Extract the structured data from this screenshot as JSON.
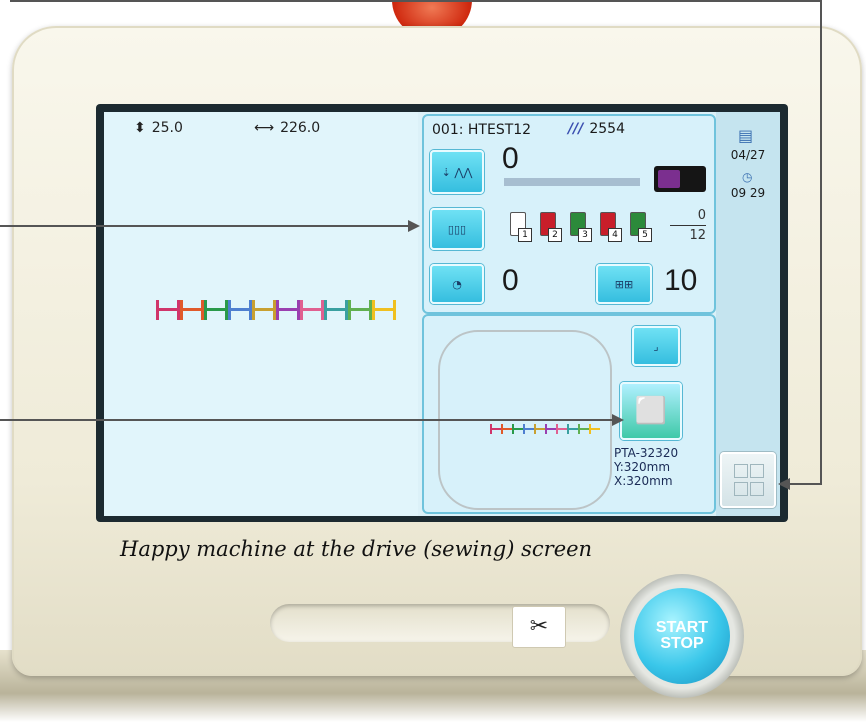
{
  "header": {
    "app_title": "",
    "dim_height": "25.0",
    "dim_width": "226.0"
  },
  "design": {
    "name": "001: HTEST12",
    "total_stitches": "2554"
  },
  "current_stitch": "0",
  "needles": {
    "count": "0",
    "total": "12",
    "spool_labels": [
      "1",
      "2",
      "3",
      "4",
      "5"
    ],
    "spool_colors": [
      "#ffffff",
      "#c81e2a",
      "#2c8a3a",
      "#c81e2a",
      "#2c8a3a"
    ]
  },
  "speed": "0",
  "needle_number": "10",
  "hoop": {
    "name": "PTA-32320",
    "y": "Y:320mm",
    "x": "X:320mm"
  },
  "clock": {
    "date": "04/27",
    "time": "09 29"
  },
  "caption": "Happy machine at the drive (sewing) screen",
  "panel": {
    "start_line1": "START",
    "start_line2": "STOP",
    "scissor": "✂"
  },
  "colors": {
    "mark_colors": [
      "#d0356a",
      "#e05a2a",
      "#2a9a4a",
      "#4e7fd0",
      "#c8a030",
      "#9a3fb0",
      "#e06090",
      "#3aa0a0",
      "#60b050",
      "#f0c020"
    ]
  }
}
